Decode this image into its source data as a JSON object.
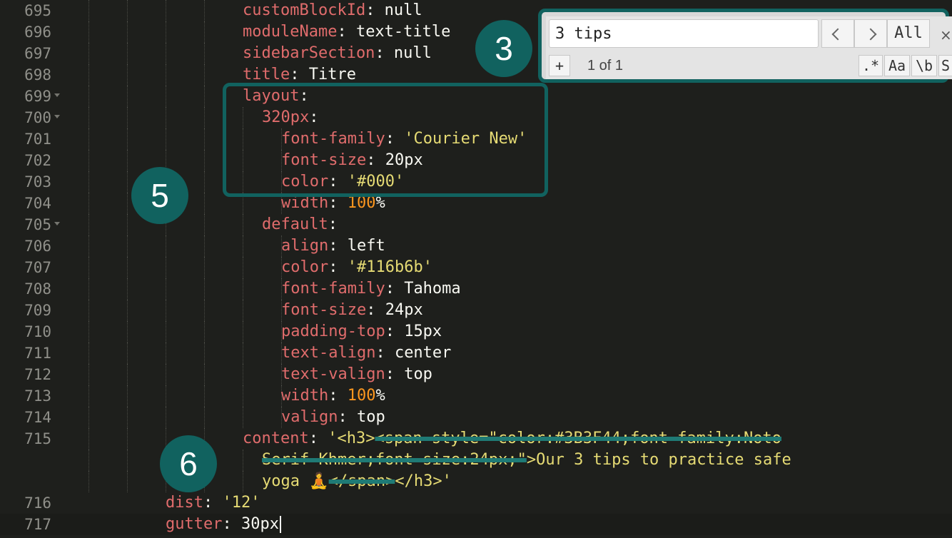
{
  "editor": {
    "lines": [
      {
        "num": "695",
        "fold": false,
        "indent": 5,
        "parts": [
          [
            "k2",
            "customBlockId"
          ],
          [
            "v",
            ": null"
          ]
        ]
      },
      {
        "num": "696",
        "fold": false,
        "indent": 5,
        "parts": [
          [
            "k2",
            "moduleName"
          ],
          [
            "v",
            ": text-title"
          ]
        ]
      },
      {
        "num": "697",
        "fold": false,
        "indent": 5,
        "parts": [
          [
            "k2",
            "sidebarSection"
          ],
          [
            "v",
            ": null"
          ]
        ]
      },
      {
        "num": "698",
        "fold": false,
        "indent": 5,
        "parts": [
          [
            "k2",
            "title"
          ],
          [
            "v",
            ": Titre"
          ]
        ]
      },
      {
        "num": "699",
        "fold": true,
        "indent": 5,
        "parts": [
          [
            "k2",
            "layout"
          ],
          [
            "v",
            ":"
          ]
        ]
      },
      {
        "num": "700",
        "fold": true,
        "indent": 6,
        "parts": [
          [
            "k2",
            "320px"
          ],
          [
            "v",
            ":"
          ]
        ]
      },
      {
        "num": "701",
        "fold": false,
        "indent": 7,
        "parts": [
          [
            "k2",
            "font-family"
          ],
          [
            "v",
            ": "
          ],
          [
            "s",
            "'Courier New'"
          ]
        ]
      },
      {
        "num": "702",
        "fold": false,
        "indent": 7,
        "parts": [
          [
            "k2",
            "font-size"
          ],
          [
            "v",
            ": 20px"
          ]
        ]
      },
      {
        "num": "703",
        "fold": false,
        "indent": 7,
        "parts": [
          [
            "k2",
            "color"
          ],
          [
            "v",
            ": "
          ],
          [
            "s",
            "'#000'"
          ]
        ]
      },
      {
        "num": "704",
        "fold": false,
        "indent": 7,
        "parts": [
          [
            "k2",
            "width"
          ],
          [
            "v",
            ": "
          ],
          [
            "n",
            "100"
          ],
          [
            "v",
            "%"
          ]
        ]
      },
      {
        "num": "705",
        "fold": true,
        "indent": 6,
        "parts": [
          [
            "k2",
            "default"
          ],
          [
            "v",
            ":"
          ]
        ]
      },
      {
        "num": "706",
        "fold": false,
        "indent": 7,
        "parts": [
          [
            "k2",
            "align"
          ],
          [
            "v",
            ": left"
          ]
        ]
      },
      {
        "num": "707",
        "fold": false,
        "indent": 7,
        "parts": [
          [
            "k2",
            "color"
          ],
          [
            "v",
            ": "
          ],
          [
            "s",
            "'#116b6b'"
          ]
        ]
      },
      {
        "num": "708",
        "fold": false,
        "indent": 7,
        "parts": [
          [
            "k2",
            "font-family"
          ],
          [
            "v",
            ": Tahoma"
          ]
        ]
      },
      {
        "num": "709",
        "fold": false,
        "indent": 7,
        "parts": [
          [
            "k2",
            "font-size"
          ],
          [
            "v",
            ": 24px"
          ]
        ]
      },
      {
        "num": "710",
        "fold": false,
        "indent": 7,
        "parts": [
          [
            "k2",
            "padding-top"
          ],
          [
            "v",
            ": 15px"
          ]
        ]
      },
      {
        "num": "711",
        "fold": false,
        "indent": 7,
        "parts": [
          [
            "k2",
            "text-align"
          ],
          [
            "v",
            ": center"
          ]
        ]
      },
      {
        "num": "712",
        "fold": false,
        "indent": 7,
        "parts": [
          [
            "k2",
            "text-valign"
          ],
          [
            "v",
            ": top"
          ]
        ]
      },
      {
        "num": "713",
        "fold": false,
        "indent": 7,
        "parts": [
          [
            "k2",
            "width"
          ],
          [
            "v",
            ": "
          ],
          [
            "n",
            "100"
          ],
          [
            "v",
            "%"
          ]
        ]
      },
      {
        "num": "714",
        "fold": false,
        "indent": 7,
        "parts": [
          [
            "k2",
            "valign"
          ],
          [
            "v",
            ": top"
          ]
        ]
      },
      {
        "num": "715",
        "fold": false,
        "indent": 5,
        "parts": [
          [
            "k2",
            "content"
          ],
          [
            "v",
            ": "
          ],
          [
            "s",
            "'<h3>"
          ],
          [
            "sx",
            "<span style=\"color:#3B3F44;font-family:Noto"
          ]
        ]
      },
      {
        "num": "",
        "fold": false,
        "indent": 6,
        "parts": [
          [
            "sx",
            "Serif Khmer;font-size:24px;\""
          ],
          [
            "s",
            ">Our 3 tips to practice safe"
          ]
        ]
      },
      {
        "num": "",
        "fold": false,
        "indent": 6,
        "parts": [
          [
            "s",
            "yoga 🧘"
          ],
          [
            "sx",
            "</span>"
          ],
          [
            "s",
            "</h3>'"
          ]
        ]
      },
      {
        "num": "716",
        "fold": false,
        "indent": 1,
        "parts": [
          [
            "k2",
            "dist"
          ],
          [
            "v",
            ": "
          ],
          [
            "s",
            "'12'"
          ]
        ]
      },
      {
        "num": "717",
        "fold": false,
        "indent": 1,
        "parts": [
          [
            "k2",
            "gutter"
          ],
          [
            "v",
            ": 30px"
          ]
        ],
        "active": true
      }
    ]
  },
  "findbar": {
    "query": "3 tips",
    "prev_label": "<",
    "next_label": ">",
    "all_label": "All",
    "close_label": "×",
    "add_label": "+",
    "match_count": "1 of 1",
    "regex_label": ".*",
    "case_label": "Aa",
    "word_label": "\\b",
    "selection_label": "S"
  },
  "annotations": {
    "badge_find": "3",
    "badge_layout": "5",
    "badge_content": "6"
  },
  "colors": {
    "accent": "#11625f",
    "background": "#1e1f1c",
    "key": "#e06c6c",
    "string": "#e6db74",
    "number": "#fd971f"
  }
}
